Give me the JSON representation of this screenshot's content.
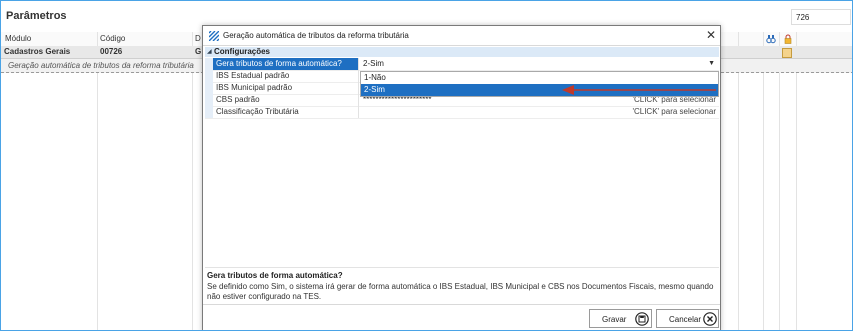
{
  "background": {
    "title": "Parâmetros",
    "search_value": "726",
    "columns": [
      "Módulo",
      "Código",
      "D"
    ],
    "row1": {
      "module": "Cadastros Gerais",
      "code": "00726",
      "desc": "G"
    },
    "row2": {
      "description": "Geração automática de tributos da reforma tributária"
    }
  },
  "dialog": {
    "title": "Geração automática de tributos da reforma tributária",
    "category": "Configurações",
    "properties": [
      {
        "name": "Gera tributos de forma automática?",
        "value": "2-Sim",
        "hint": ""
      },
      {
        "name": "IBS Estadual padrão",
        "value": "",
        "hint": ""
      },
      {
        "name": "IBS Municipal padrão",
        "value": "",
        "hint": ""
      },
      {
        "name": "CBS padrão",
        "value": "**********************",
        "hint": "'CLICK' para selecionar"
      },
      {
        "name": "Classificação Tributária",
        "value": "",
        "hint": "'CLICK' para selecionar"
      }
    ],
    "dropdown_options": [
      "1-Não",
      "2-Sim"
    ],
    "dropdown_selected": "2-Sim",
    "description_title": "Gera tributos de forma automática?",
    "description_body": "Se definido como Sim, o sistema irá gerar de forma automática o IBS Estadual, IBS Municipal e CBS nos Documentos Fiscais, mesmo quando não estiver configurado na TES.",
    "buttons": {
      "save": "Gravar",
      "cancel": "Cancelar"
    },
    "accent_color": "#1e6fc2",
    "annotation_arrow_color": "#c0392b"
  }
}
